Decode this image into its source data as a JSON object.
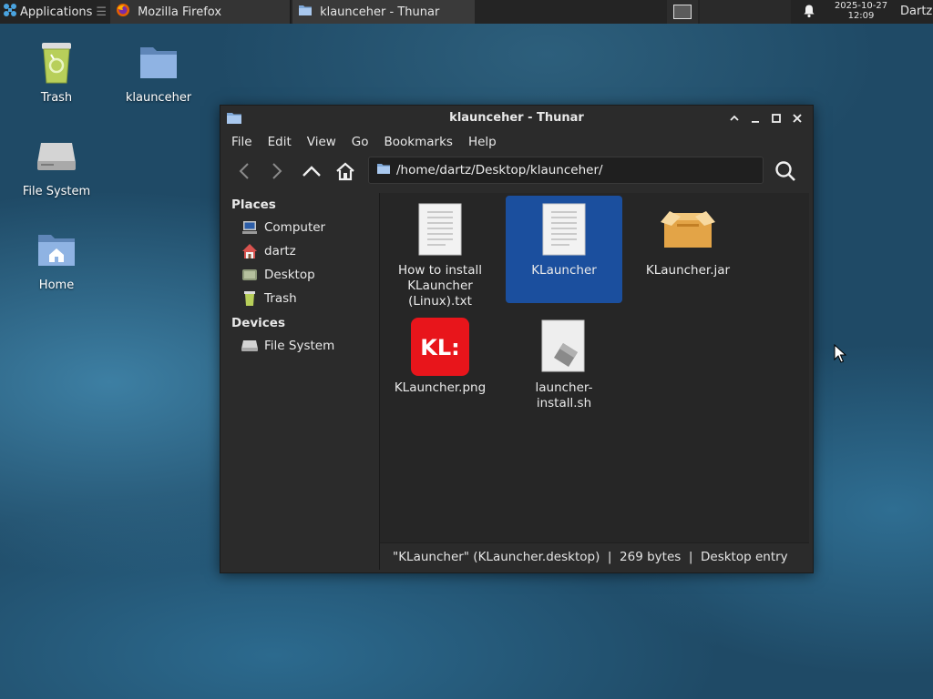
{
  "panel": {
    "applications_label": "Applications",
    "applications_separator": "☰",
    "tasks": [
      {
        "label": "Mozilla Firefox",
        "icon": "firefox-icon"
      },
      {
        "label": "klaunceher - Thunar",
        "icon": "folder-icon"
      }
    ],
    "clock_date": "2025-10-27",
    "clock_time": "12:09",
    "user": "Dartz"
  },
  "desktop": {
    "icons": [
      {
        "label": "Trash",
        "icon": "trash-icon"
      },
      {
        "label": "klaunceher",
        "icon": "folder-icon"
      },
      {
        "label": "File System",
        "icon": "drive-icon"
      },
      {
        "label": "Home",
        "icon": "home-folder-icon"
      }
    ]
  },
  "window": {
    "title": "klaunceher - Thunar",
    "menu": [
      "File",
      "Edit",
      "View",
      "Go",
      "Bookmarks",
      "Help"
    ],
    "path": "/home/dartz/Desktop/klaunceher/",
    "sidebar": {
      "places_header": "Places",
      "places": [
        {
          "label": "Computer",
          "icon": "computer-icon"
        },
        {
          "label": "dartz",
          "icon": "home-icon"
        },
        {
          "label": "Desktop",
          "icon": "desktop-icon"
        },
        {
          "label": "Trash",
          "icon": "trash-icon"
        }
      ],
      "devices_header": "Devices",
      "devices": [
        {
          "label": "File System",
          "icon": "drive-icon"
        }
      ]
    },
    "files": [
      {
        "label": "How to install KLauncher (Linux).txt",
        "icon": "text-document-icon",
        "selected": false
      },
      {
        "label": "KLauncher",
        "icon": "text-document-icon",
        "selected": true
      },
      {
        "label": "KLauncher.jar",
        "icon": "package-icon",
        "selected": false
      },
      {
        "label": "KLauncher.png",
        "icon": "image-icon",
        "selected": false,
        "image_text": "KL:"
      },
      {
        "label": "launcher-install.sh",
        "icon": "script-icon",
        "selected": false
      }
    ],
    "status": "\"KLauncher\" (KLauncher.desktop)  |  269 bytes  |  Desktop entry"
  },
  "colors": {
    "selection": "#1b4f9e",
    "panel_bg": "#242424",
    "window_bg": "#2b2b2b",
    "desktop_bg": "#1f4a66",
    "image_red": "#e8151b"
  }
}
